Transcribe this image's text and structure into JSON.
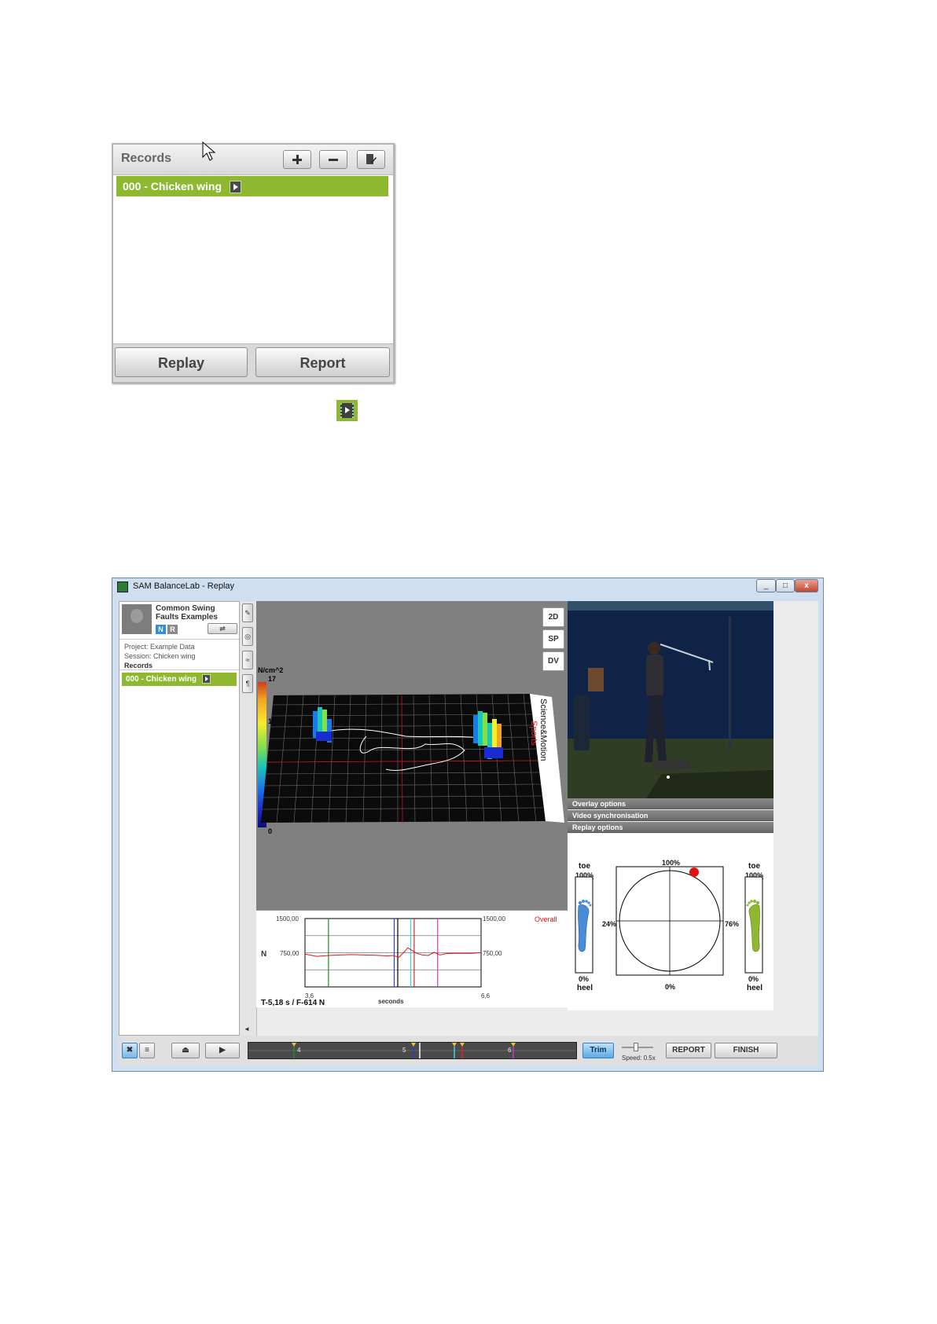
{
  "records_panel": {
    "title": "Records",
    "add_icon": "plus-icon",
    "remove_icon": "minus-icon",
    "edit_icon": "edit-note-icon",
    "selected_record": "000 - Chicken wing",
    "replay_label": "Replay",
    "report_label": "Report"
  },
  "window": {
    "title": "SAM BalanceLab - Replay",
    "minimize_label": "_",
    "maximize_label": "□",
    "close_label": "x"
  },
  "sidebar": {
    "user_name": "Common Swing Faults Examples",
    "badge_n": "N",
    "badge_r": "R",
    "swap_label": "⇌",
    "project": "Project: Example Data",
    "session": "Session: Chicken wing",
    "records_heading": "Records",
    "record_item": "000 - Chicken wing"
  },
  "toolstrip": [
    "✎",
    "◎",
    "≈",
    "¶"
  ],
  "view3d": {
    "modes": [
      "2D",
      "SP",
      "DV"
    ],
    "unit": "N/cm^2",
    "scale_max": "17",
    "scale_mid": "1",
    "scale_min": "0",
    "brand_line1": "Science&Motion",
    "brand_line2": "Sports",
    "colors": {
      "brand_red": "#d32f2f",
      "grid": "#ffffff"
    }
  },
  "force_chart": {
    "ylabel": "N",
    "y_top_left": "1500,00",
    "y_mid_left": "750,00",
    "y_top_right": "1500,00",
    "y_mid_right": "750,00",
    "x_min": "3,6",
    "x_max": "6,6",
    "xlabel": "seconds",
    "series_label": "Overall",
    "readout": "T-5,18 s / F-614 N",
    "chart_data": {
      "type": "line",
      "xlim": [
        3.6,
        6.6
      ],
      "ylim": [
        0,
        1500
      ],
      "series": [
        {
          "name": "Overall",
          "x": [
            3.6,
            3.8,
            4.0,
            4.2,
            4.4,
            4.6,
            4.8,
            5.0,
            5.1,
            5.2,
            5.3,
            5.35,
            5.4,
            5.5,
            5.6,
            5.7,
            5.8,
            5.9,
            6.0,
            6.2,
            6.4,
            6.6
          ],
          "y": [
            720,
            670,
            690,
            700,
            710,
            700,
            695,
            680,
            690,
            650,
            780,
            860,
            820,
            740,
            700,
            690,
            760,
            700,
            730,
            740,
            735,
            750
          ]
        }
      ],
      "markers": [
        {
          "x": 4.0,
          "color": "#1f8a2a"
        },
        {
          "x": 5.12,
          "color": "#2c3ed8"
        },
        {
          "x": 5.18,
          "color": "#000000"
        },
        {
          "x": 5.4,
          "color": "#38d4ea"
        },
        {
          "x": 5.46,
          "color": "#d62828"
        },
        {
          "x": 5.86,
          "color": "#c837c8"
        }
      ],
      "grid": true
    }
  },
  "right_panel": {
    "accordion": [
      "Overlay options",
      "Video synchronisation",
      "Replay options"
    ],
    "balance": {
      "toe_left": "toe",
      "toe_right": "toe",
      "left_top_pct": "100%",
      "right_top_pct": "100%",
      "left_bottom_pct": "0%",
      "right_bottom_pct": "0%",
      "heel_left": "heel",
      "heel_right": "heel",
      "circle_top": "100%",
      "circle_left": "24%",
      "circle_right": "76%",
      "circle_bottom": "0%",
      "colors": {
        "left_foot": "#4a8bd6",
        "right_foot": "#8db830",
        "marker": "#e01414"
      }
    }
  },
  "bottombar": {
    "tools_icon": "wrench-icon",
    "list_icon": "list-icon",
    "eject_icon": "eject-icon",
    "play_icon": "play-icon",
    "timeline_ticks": [
      "4",
      "5",
      "6"
    ],
    "trim_label": "Trim",
    "speed_label": "Speed: 0.5x",
    "report_label": "REPORT",
    "finish_label": "FINISH"
  }
}
